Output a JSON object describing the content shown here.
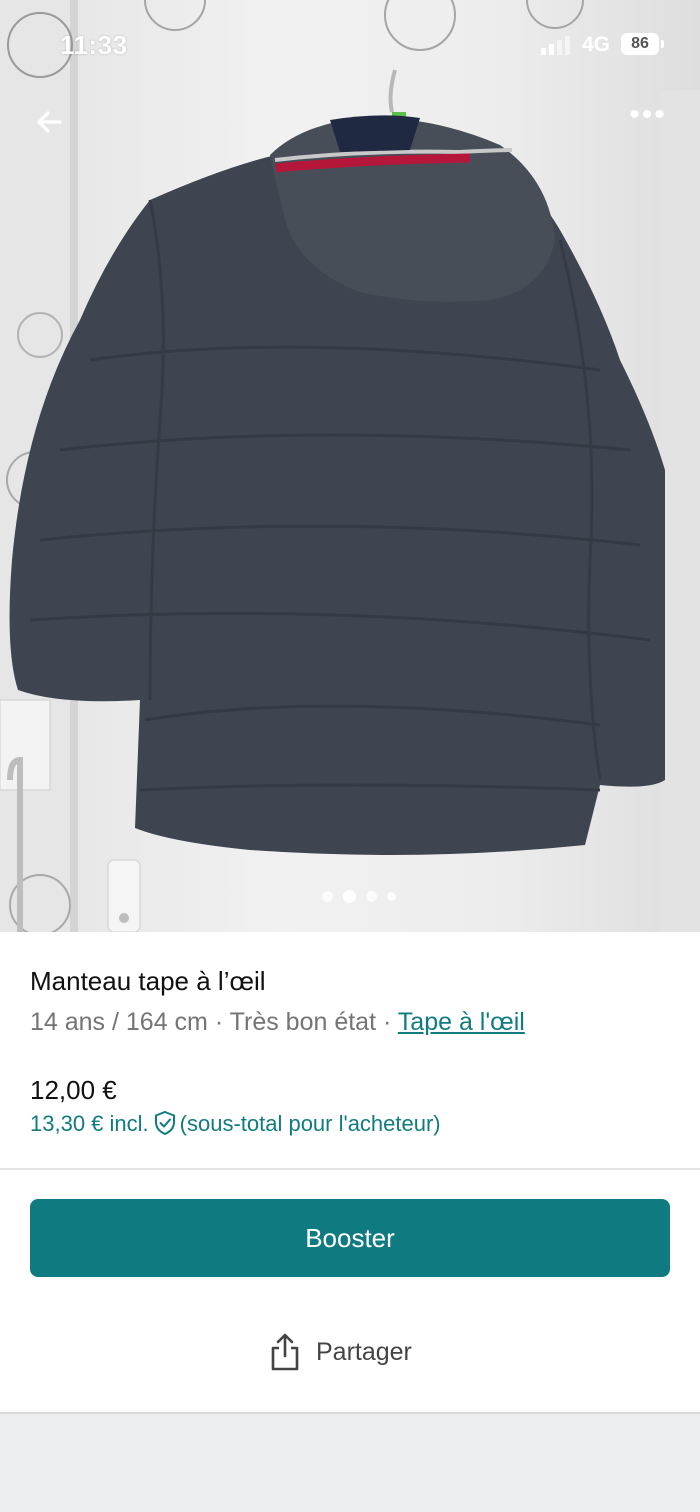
{
  "status_bar": {
    "time": "11:33",
    "network": "4G",
    "battery": "86"
  },
  "photo": {
    "carousel_count": 4,
    "active_index": 1
  },
  "item": {
    "title": "Manteau tape à l’œil",
    "size": "14 ans / 164 cm",
    "separator_1": " · ",
    "condition": "Très bon état",
    "separator_2": " · ",
    "brand": "Tape à l'œil",
    "price": "12,00 €",
    "buyer_total": "13,30 € incl.",
    "buyer_note": "(sous-total pour l'acheteur)"
  },
  "actions": {
    "boost_label": "Booster",
    "share_label": "Partager"
  },
  "colors": {
    "accent": "#0f7a80",
    "link": "#117c7f",
    "jacket": "#3f4650"
  }
}
